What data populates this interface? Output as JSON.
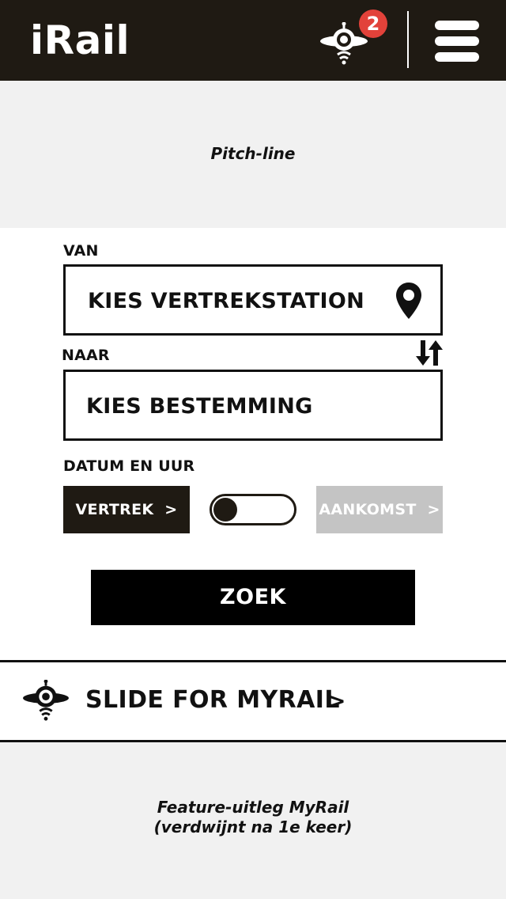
{
  "header": {
    "logo": "iRail",
    "notification_count": "2"
  },
  "pitch": {
    "text": "Pitch-line"
  },
  "form": {
    "from_label": "VAN",
    "from_placeholder": "KIES VERTREKSTATION",
    "to_label": "NAAR",
    "to_placeholder": "KIES BESTEMMING",
    "datetime_label": "DATUM EN UUR",
    "departure_label": "VERTREK  >",
    "arrival_label": "AANKOMST  >",
    "search_label": "ZOEK"
  },
  "myrail": {
    "label": "SLIDE FOR MYRAIL",
    "chevron": ">"
  },
  "feature": {
    "line1": "Feature-uitleg MyRail",
    "line2": "(verdwijnt na 1e keer)"
  },
  "colors": {
    "header_bg": "#1f1a13",
    "badge": "#e2423a",
    "inactive_button": "#c4c4c4",
    "search_button": "#000000"
  },
  "icons": {
    "notification": "robot-icon",
    "menu": "hamburger-menu-icon",
    "location": "location-pin-icon",
    "swap": "swap-arrows-icon",
    "myrail": "robot-icon"
  },
  "toggle": {
    "state": "departure"
  }
}
